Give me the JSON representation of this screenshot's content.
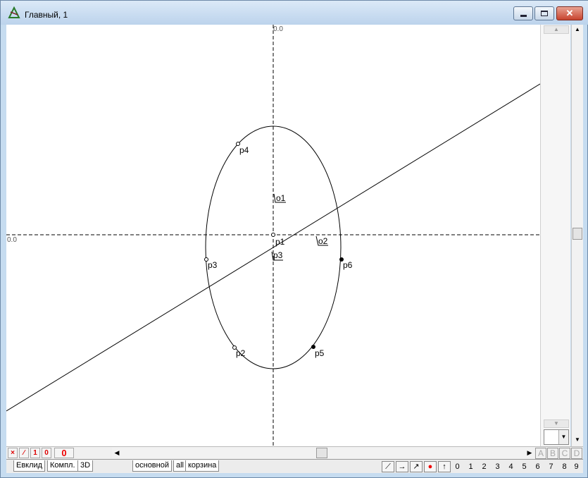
{
  "window": {
    "title": "Главный, 1",
    "controls": {
      "minimize": "min",
      "maximize": "max",
      "close": "✕"
    }
  },
  "canvas": {
    "axis_label_x": "0.0",
    "axis_label_y": "0.0",
    "points": [
      {
        "label": "p1",
        "style": "open"
      },
      {
        "label": "p2",
        "style": "open"
      },
      {
        "label": "p3",
        "style": "open"
      },
      {
        "label": "p4",
        "style": "open"
      },
      {
        "label": "p5",
        "style": "filled"
      },
      {
        "label": "p6",
        "style": "filled"
      }
    ],
    "markers": [
      "o1",
      "o2",
      "p3"
    ]
  },
  "status": {
    "red_buttons": [
      "×",
      "∕",
      "1",
      "0"
    ],
    "counter": "0",
    "letter_buttons": [
      "A",
      "B",
      "C",
      "D"
    ]
  },
  "tabs": {
    "left": [
      "Евклид",
      "Компл.",
      "3D"
    ],
    "layers": [
      "основной",
      "all",
      "корзина"
    ]
  },
  "toolbar": {
    "tool_icons": [
      "segment-tool-icon",
      "arrow-right-icon",
      "diagonal-arrow-icon",
      "red-point-icon",
      "arrow-up-icon"
    ],
    "numbers": [
      "0",
      "1",
      "2",
      "3",
      "4",
      "5",
      "6",
      "7",
      "8",
      "9"
    ]
  },
  "colors": {
    "window_frame": "#c6dcf0",
    "close_button": "#c7432e",
    "counter_red": "#e00000"
  }
}
